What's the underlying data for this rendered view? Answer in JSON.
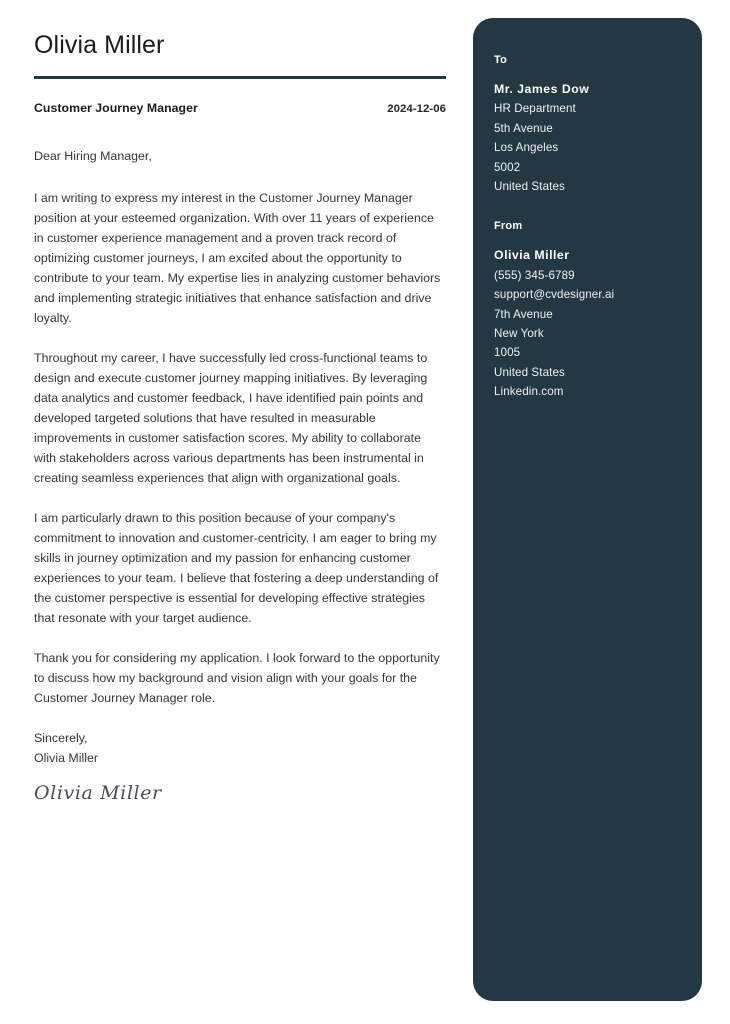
{
  "letter": {
    "name": "Olivia Miller",
    "job_title": "Customer Journey Manager",
    "date": "2024-12-06",
    "salutation": "Dear Hiring Manager,",
    "paragraphs": [
      "I am writing to express my interest in the Customer Journey Manager position at your esteemed organization. With over 11 years of experience in customer experience management and a proven track record of optimizing customer journeys, I am excited about the opportunity to contribute to your team. My expertise lies in analyzing customer behaviors and implementing strategic initiatives that enhance satisfaction and drive loyalty.",
      "Throughout my career, I have successfully led cross-functional teams to design and execute customer journey mapping initiatives. By leveraging data analytics and customer feedback, I have identified pain points and developed targeted solutions that have resulted in measurable improvements in customer satisfaction scores. My ability to collaborate with stakeholders across various departments has been instrumental in creating seamless experiences that align with organizational goals.",
      "I am particularly drawn to this position because of your company's commitment to innovation and customer-centricity. I am eager to bring my skills in journey optimization and my passion for enhancing customer experiences to your team. I believe that fostering a deep understanding of the customer perspective is essential for developing effective strategies that resonate with your target audience.",
      "Thank you for considering my application. I look forward to the opportunity to discuss how my background and vision align with your goals for the Customer Journey Manager role."
    ],
    "closing_phrase": "Sincerely,",
    "closing_name": "Olivia Miller",
    "signature": "Olivia Miller"
  },
  "sidebar": {
    "to": {
      "label": "To",
      "name": "Mr. James Dow",
      "lines": [
        "HR Department",
        "5th Avenue",
        "Los Angeles",
        "5002",
        "United States"
      ]
    },
    "from": {
      "label": "From",
      "name": "Olivia  Miller",
      "lines": [
        "(555) 345-6789",
        "support@cvdesigner.ai",
        "7th Avenue",
        "New York",
        "1005",
        "United States",
        "Linkedin.com"
      ]
    }
  },
  "colors": {
    "sidebar_background": "#233843",
    "rule": "#233843",
    "body_text": "#33383d",
    "heading_text": "#1c1c1c"
  }
}
